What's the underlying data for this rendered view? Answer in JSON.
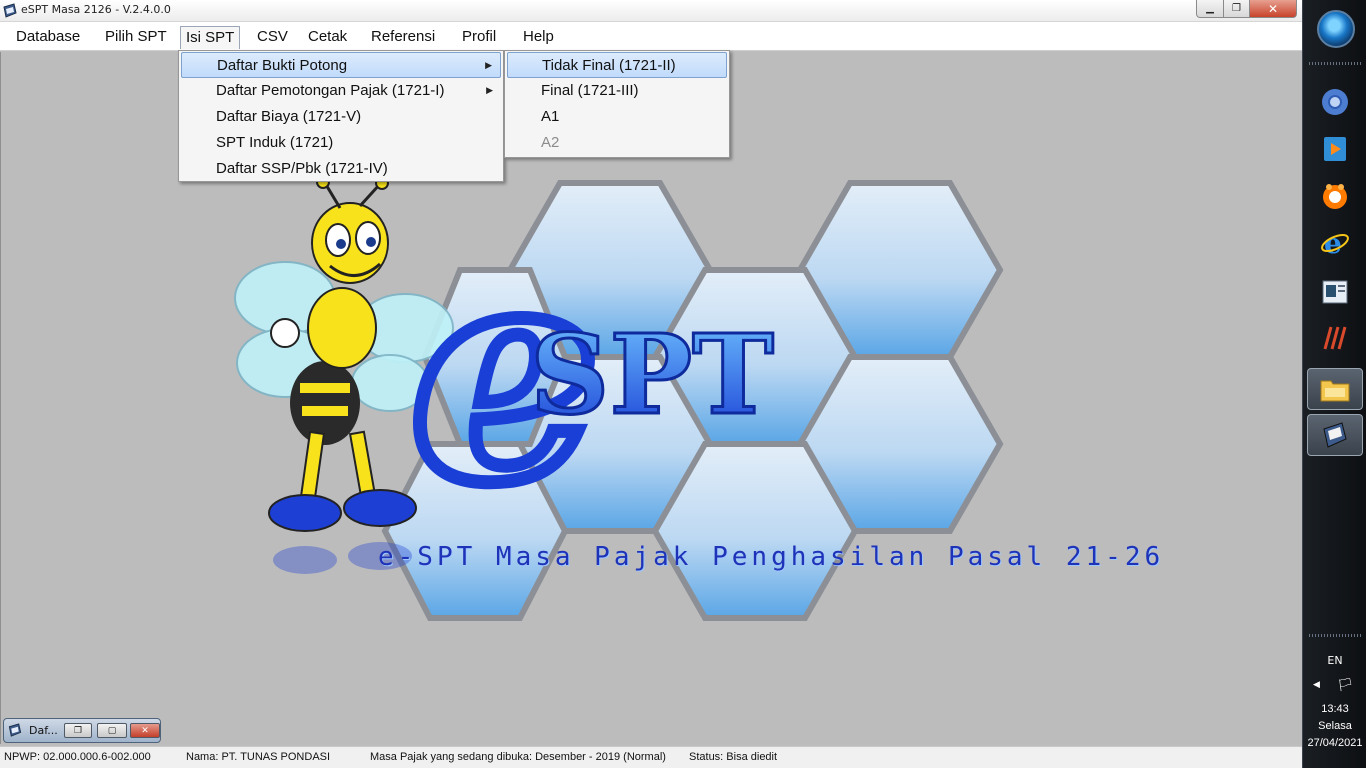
{
  "window": {
    "title": "eSPT Masa 2126 - V.2.4.0.0",
    "minimize": "▁",
    "maximize": "❐",
    "close": "✕"
  },
  "menubar": {
    "items": [
      "Database",
      "Pilih SPT",
      "Isi SPT",
      "CSV",
      "Cetak",
      "Referensi",
      "Profil",
      "Help"
    ]
  },
  "isi_spt_menu": {
    "items": [
      "Daftar Bukti Potong",
      "Daftar Pemotongan Pajak (1721-I)",
      "Daftar Biaya  (1721-V)",
      "SPT Induk  (1721)",
      "Daftar SSP/Pbk  (1721-IV)"
    ],
    "submenu_arrow": "▶"
  },
  "bukti_potong_submenu": {
    "items": [
      "Tidak Final  (1721-II)",
      "Final (1721-III)",
      "A1",
      "A2"
    ]
  },
  "splash": {
    "logo_e": "e",
    "logo_spt": "SPT",
    "caption": "e-SPT Masa Pajak Penghasilan Pasal 21-26",
    "colors": {
      "logo_blue": "#1a3fd6",
      "logo_light": "#4aa6ff",
      "hex_light": "#cfe7fb",
      "hex_dark": "#6fb3ea",
      "bee_yellow": "#f7e21b",
      "wing": "#bff2f8"
    }
  },
  "mdi_minimized": {
    "label": "Daf...",
    "restore": "❐",
    "maximize": "▢",
    "close": "✕"
  },
  "statusbar": {
    "npwp": "NPWP: 02.000.000.6-002.000",
    "nama": "Nama: PT. TUNAS PONDASI",
    "masa": "Masa Pajak yang sedang dibuka: Desember - 2019 (Normal)",
    "status": "Status: Bisa diedit"
  },
  "taskbar": {
    "icons": [
      "chrome-icon",
      "media-player-icon",
      "cursor-app-icon",
      "internet-explorer-icon",
      "reader-icon",
      "sticky-app-icon",
      "file-explorer-icon",
      "espt-icon"
    ],
    "language": "EN",
    "tray_arrow": "◀",
    "tray_flag": "🏳",
    "time": "13:43",
    "day": "Selasa",
    "date": "27/04/2021"
  }
}
